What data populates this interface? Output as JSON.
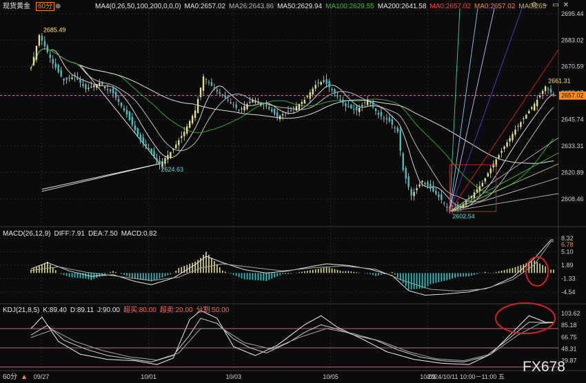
{
  "instrument": "现货黄金",
  "period_badge": "60分",
  "toolbar_icons": [
    "settings-icon",
    "minimize-icon",
    "restore-icon",
    "close-icon"
  ],
  "main_header": [
    {
      "text": "MA4(0,26,50,100,200,0,0,0)",
      "color": "#e8e8e8"
    },
    {
      "text": "MA0:2657.02",
      "color": "#e8e8e8"
    },
    {
      "text": "MA26:2643.86",
      "color": "#b8b8b8"
    },
    {
      "text": "MA50:2629.94",
      "color": "#e8e8e8"
    },
    {
      "text": "MA100:2629.55",
      "color": "#35c435"
    },
    {
      "text": "MA200:2641.58",
      "color": "#e8e8e8"
    },
    {
      "text": "MA0:2657.02",
      "color": "#ff4040"
    },
    {
      "text": "MA0:2657.02",
      "color": "#ff8c1a"
    },
    {
      "text": "MA0:265",
      "color": "#c8b63c"
    }
  ],
  "macd_header": [
    {
      "text": "MACD(26,12,9)",
      "color": "#e8e8e8"
    },
    {
      "text": "DIFF:7.91",
      "color": "#e8e8e8"
    },
    {
      "text": "DEA:7.50",
      "color": "#e8e8e8"
    },
    {
      "text": "MACD:0.82",
      "color": "#e8e8e8"
    }
  ],
  "kdj_header": [
    {
      "text": "KDJ(21,8,5)",
      "color": "#e8e8e8"
    },
    {
      "text": "K:89.40",
      "color": "#e8e8e8"
    },
    {
      "text": "D:89.11",
      "color": "#e8e8e8"
    },
    {
      "text": "J:90.00",
      "color": "#e8e8e8"
    },
    {
      "text": "超买:80.00",
      "color": "#ff6b6b"
    },
    {
      "text": "超卖:20.00",
      "color": "#ff6b6b"
    },
    {
      "text": "分割:50.00",
      "color": "#ff6b6b"
    }
  ],
  "watermark": "FX678",
  "period_footer": "60分",
  "colors": {
    "up": "#e2e08a",
    "down": "#33c8c8",
    "wick": "#d8d8d8",
    "grid": "#2a2a2a",
    "axis_text": "#d0d0d0",
    "current_price": "#ff8c1a",
    "annotation_red": "#d62020",
    "ref_band": "#ff6b6b"
  },
  "chart_data": [
    {
      "type": "candlestick",
      "title": "现货黄金 60分",
      "x_ticks": [
        "09/27",
        "10/01",
        "10/03",
        "10/05",
        "10/09"
      ],
      "x_footer_label": "2024/10/11 10:00－11:00 五",
      "y_ticks": [
        2695.44,
        2683.02,
        2670.59,
        2658.17,
        2645.74,
        2633.31,
        2620.89,
        2608.46
      ],
      "ylim": [
        2599,
        2698
      ],
      "grid": true,
      "current_price": 2657.02,
      "annotations": [
        {
          "label": "2685.49",
          "value": 2685.49,
          "kind": "high"
        },
        {
          "label": "2624.63",
          "value": 2624.63,
          "kind": "low"
        },
        {
          "label": "2602.54",
          "value": 2602.54,
          "kind": "low"
        },
        {
          "label": "2661.31",
          "value": 2661.31,
          "kind": "high"
        }
      ],
      "ma_lines": [
        "MA26",
        "MA50",
        "MA100",
        "MA200"
      ],
      "price_path": [
        [
          0,
          2670
        ],
        [
          3,
          2685.49
        ],
        [
          8,
          2672
        ],
        [
          12,
          2664
        ],
        [
          16,
          2666
        ],
        [
          20,
          2660
        ],
        [
          25,
          2663
        ],
        [
          30,
          2658
        ],
        [
          35,
          2648
        ],
        [
          40,
          2636
        ],
        [
          44,
          2630
        ],
        [
          47,
          2624.63
        ],
        [
          52,
          2632
        ],
        [
          56,
          2640
        ],
        [
          60,
          2650
        ],
        [
          63,
          2666
        ],
        [
          67,
          2660
        ],
        [
          72,
          2655
        ],
        [
          76,
          2650
        ],
        [
          81,
          2655
        ],
        [
          86,
          2652
        ],
        [
          90,
          2647
        ],
        [
          95,
          2650
        ],
        [
          100,
          2655
        ],
        [
          104,
          2662
        ],
        [
          107,
          2664
        ],
        [
          111,
          2658
        ],
        [
          115,
          2652
        ],
        [
          119,
          2650
        ],
        [
          123,
          2655
        ],
        [
          127,
          2648
        ],
        [
          131,
          2645
        ],
        [
          134,
          2640
        ],
        [
          136,
          2622
        ],
        [
          139,
          2610
        ],
        [
          143,
          2617
        ],
        [
          147,
          2612
        ],
        [
          150,
          2608
        ],
        [
          153,
          2602.54
        ],
        [
          157,
          2605
        ],
        [
          161,
          2610
        ],
        [
          165,
          2616
        ],
        [
          169,
          2625
        ],
        [
          173,
          2633
        ],
        [
          177,
          2641
        ],
        [
          181,
          2648
        ],
        [
          185,
          2655
        ],
        [
          188,
          2661.31
        ],
        [
          191,
          2657.02
        ]
      ],
      "n_bars": 192
    },
    {
      "type": "bar",
      "title": "MACD(26,12,9)",
      "y_ticks": [
        8.32,
        5.1,
        1.89,
        -1.33,
        -4.54
      ],
      "ylim": [
        -6.2,
        9.6
      ],
      "current_label": "6.78",
      "series": [
        {
          "name": "DIFF",
          "value": 7.91
        },
        {
          "name": "DEA",
          "value": 7.5
        },
        {
          "name": "MACD",
          "value": 0.82
        }
      ],
      "diff_path": [
        [
          0,
          1.0
        ],
        [
          6,
          2.5
        ],
        [
          14,
          0.5
        ],
        [
          22,
          -0.8
        ],
        [
          30,
          -0.4
        ],
        [
          38,
          -2.0
        ],
        [
          44,
          -2.8
        ],
        [
          52,
          -1.2
        ],
        [
          60,
          2.0
        ],
        [
          64,
          4.0
        ],
        [
          70,
          2.5
        ],
        [
          78,
          0.8
        ],
        [
          86,
          0.0
        ],
        [
          94,
          0.5
        ],
        [
          102,
          1.5
        ],
        [
          108,
          2.2
        ],
        [
          116,
          1.8
        ],
        [
          124,
          0.9
        ],
        [
          132,
          -0.6
        ],
        [
          138,
          -4.2
        ],
        [
          144,
          -5.3
        ],
        [
          152,
          -5.0
        ],
        [
          160,
          -4.5
        ],
        [
          168,
          -3.4
        ],
        [
          176,
          -1.0
        ],
        [
          184,
          3.5
        ],
        [
          190,
          7.91
        ],
        [
          191,
          7.91
        ]
      ],
      "dea_path": [
        [
          0,
          0.6
        ],
        [
          10,
          1.5
        ],
        [
          20,
          0.2
        ],
        [
          32,
          -0.8
        ],
        [
          44,
          -1.8
        ],
        [
          54,
          -1.0
        ],
        [
          62,
          1.2
        ],
        [
          70,
          2.2
        ],
        [
          80,
          1.4
        ],
        [
          92,
          0.5
        ],
        [
          104,
          1.3
        ],
        [
          114,
          1.7
        ],
        [
          126,
          0.9
        ],
        [
          136,
          -1.8
        ],
        [
          146,
          -3.9
        ],
        [
          156,
          -4.3
        ],
        [
          166,
          -3.8
        ],
        [
          176,
          -1.6
        ],
        [
          184,
          2.0
        ],
        [
          190,
          7.5
        ],
        [
          191,
          7.5
        ]
      ]
    },
    {
      "type": "line",
      "title": "KDJ(21,8,5)",
      "y_ticks": [
        103.62,
        85.18,
        66.75,
        48.31,
        29.87
      ],
      "ylim": [
        21,
        110
      ],
      "ref_lines": [
        80,
        50,
        20
      ],
      "series": [
        {
          "name": "K",
          "value": 89.4
        },
        {
          "name": "D",
          "value": 89.11
        },
        {
          "name": "J",
          "value": 90.0
        }
      ],
      "k_path": [
        [
          0,
          70
        ],
        [
          6,
          85
        ],
        [
          12,
          62
        ],
        [
          20,
          48
        ],
        [
          28,
          38
        ],
        [
          36,
          33
        ],
        [
          44,
          28
        ],
        [
          52,
          38
        ],
        [
          58,
          70
        ],
        [
          62,
          96
        ],
        [
          68,
          88
        ],
        [
          74,
          64
        ],
        [
          80,
          50
        ],
        [
          86,
          42
        ],
        [
          94,
          58
        ],
        [
          100,
          74
        ],
        [
          106,
          86
        ],
        [
          112,
          79
        ],
        [
          118,
          70
        ],
        [
          126,
          62
        ],
        [
          134,
          47
        ],
        [
          142,
          36
        ],
        [
          150,
          30
        ],
        [
          158,
          28
        ],
        [
          166,
          36
        ],
        [
          174,
          62
        ],
        [
          182,
          90
        ],
        [
          188,
          89.4
        ],
        [
          191,
          89.4
        ]
      ],
      "d_path": [
        [
          0,
          66
        ],
        [
          8,
          78
        ],
        [
          16,
          60
        ],
        [
          26,
          46
        ],
        [
          36,
          36
        ],
        [
          46,
          31
        ],
        [
          54,
          42
        ],
        [
          62,
          80
        ],
        [
          70,
          80
        ],
        [
          78,
          58
        ],
        [
          88,
          48
        ],
        [
          98,
          66
        ],
        [
          108,
          80
        ],
        [
          118,
          72
        ],
        [
          128,
          60
        ],
        [
          138,
          44
        ],
        [
          148,
          33
        ],
        [
          158,
          30
        ],
        [
          168,
          40
        ],
        [
          178,
          70
        ],
        [
          186,
          88
        ],
        [
          191,
          89.11
        ]
      ],
      "j_path": [
        [
          0,
          80
        ],
        [
          4,
          98
        ],
        [
          10,
          60
        ],
        [
          18,
          40
        ],
        [
          28,
          32
        ],
        [
          38,
          30
        ],
        [
          46,
          24
        ],
        [
          52,
          34
        ],
        [
          58,
          94
        ],
        [
          62,
          108
        ],
        [
          68,
          96
        ],
        [
          74,
          52
        ],
        [
          82,
          38
        ],
        [
          90,
          54
        ],
        [
          100,
          86
        ],
        [
          106,
          100
        ],
        [
          112,
          82
        ],
        [
          120,
          66
        ],
        [
          130,
          44
        ],
        [
          140,
          32
        ],
        [
          150,
          26
        ],
        [
          160,
          24
        ],
        [
          168,
          40
        ],
        [
          176,
          74
        ],
        [
          182,
          100
        ],
        [
          188,
          90
        ],
        [
          191,
          90
        ]
      ]
    }
  ]
}
